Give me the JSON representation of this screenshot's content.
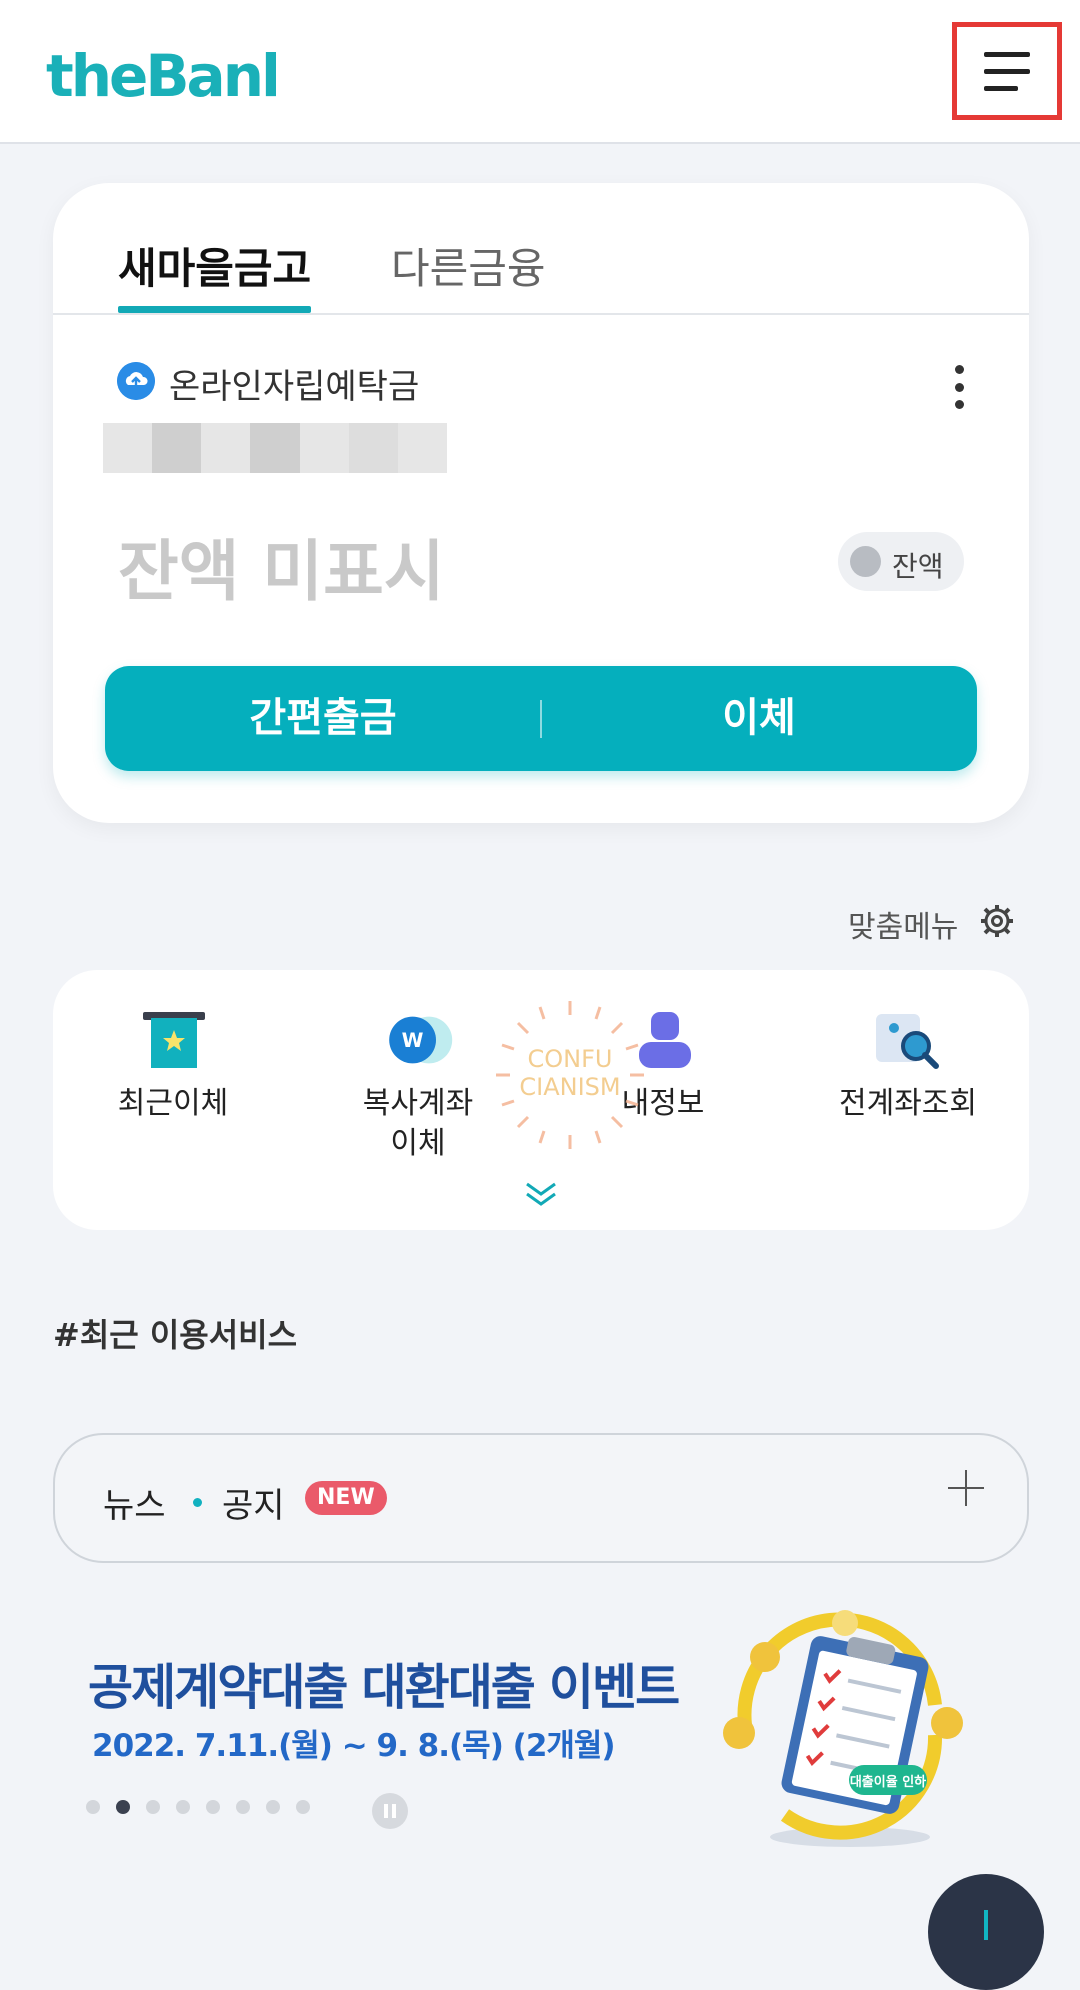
{
  "header": {
    "logo_text": "theBank",
    "menu_icon": "hamburger-menu-icon"
  },
  "account_card": {
    "tabs": [
      {
        "label": "새마을금고",
        "active": true
      },
      {
        "label": "다른금융",
        "active": false
      }
    ],
    "account_icon": "cloud-upload-icon",
    "account_name": "온라인자립예탁금",
    "more_icon": "more-vertical-icon",
    "balance_hidden_text": "잔액 미표시",
    "balance_toggle_label": "잔액",
    "actions": {
      "quick_withdraw": "간편출금",
      "transfer": "이체"
    }
  },
  "custom_menu": {
    "label": "맞춤메뉴",
    "settings_icon": "gear-icon",
    "items": [
      {
        "icon": "receipt-star-icon",
        "label": "최근이체"
      },
      {
        "icon": "multi-account-icon",
        "label": "복사계좌\n이체"
      },
      {
        "icon": "user-icon",
        "label": "내정보"
      },
      {
        "icon": "account-search-icon",
        "label": "전계좌조회"
      }
    ],
    "expand_icon": "double-chevron-down-icon"
  },
  "recent_services": {
    "title": "#최근 이용서비스"
  },
  "news": {
    "label_news": "뉴스",
    "label_notice": "공지",
    "badge": "NEW",
    "plus_icon": "plus-icon"
  },
  "banner": {
    "title": "공제계약대출 대환대출 이벤트",
    "subtitle": "2022. 7.11.(월) ~ 9. 8.(목) (2개월)",
    "art_badge": "대출이율 인하",
    "page_count": 8,
    "current_page": 2
  },
  "watermark": {
    "line1": "CONFU",
    "line2": "CIANISM"
  },
  "colors": {
    "accent": "#05afbd",
    "background": "#f2f4f8",
    "banner_title": "#1f4f9d",
    "badge": "#ea5a6a"
  }
}
